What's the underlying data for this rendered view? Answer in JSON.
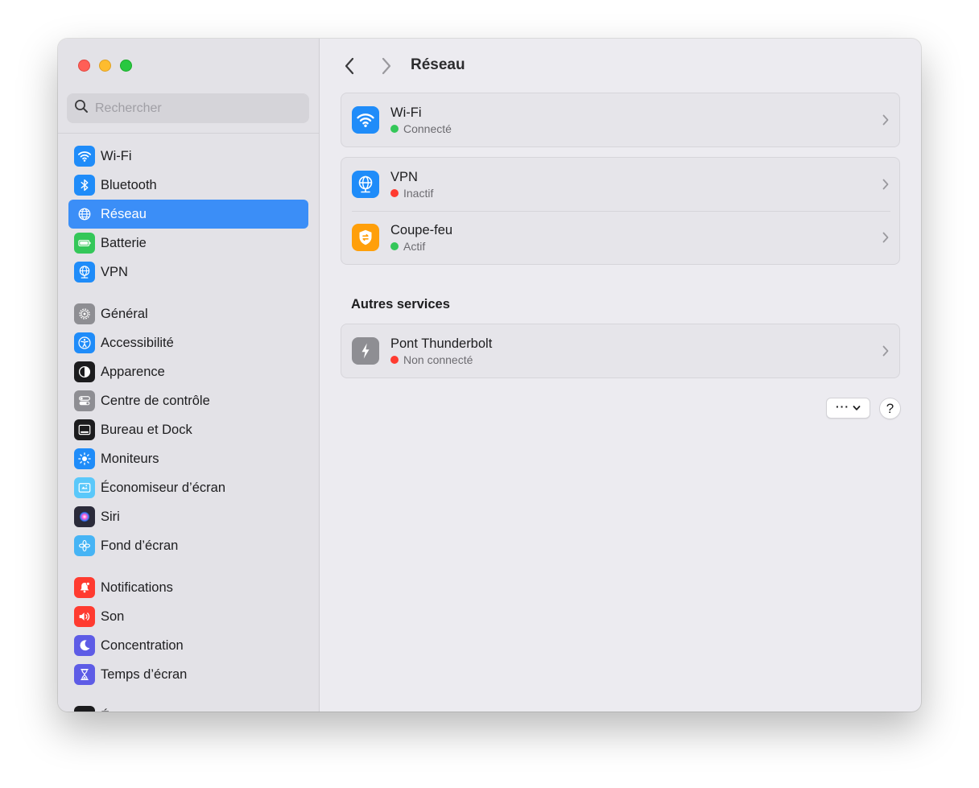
{
  "window": {
    "title": "Réseau"
  },
  "search": {
    "placeholder": "Rechercher"
  },
  "sidebar": {
    "groups": [
      [
        {
          "label": "Wi-Fi",
          "icon": "wifi-icon",
          "color": "#1f8cf9"
        },
        {
          "label": "Bluetooth",
          "icon": "bluetooth-icon",
          "color": "#1f8cf9"
        },
        {
          "label": "Réseau",
          "icon": "globe-icon",
          "color": "#1f8cf9",
          "selected": true
        },
        {
          "label": "Batterie",
          "icon": "battery-icon",
          "color": "#34c759"
        },
        {
          "label": "VPN",
          "icon": "vpn-globe-icon",
          "color": "#1f8cf9"
        }
      ],
      [
        {
          "label": "Général",
          "icon": "gear-icon",
          "color": "#8e8e93"
        },
        {
          "label": "Accessibilité",
          "icon": "accessibility-icon",
          "color": "#1f8cf9"
        },
        {
          "label": "Apparence",
          "icon": "appearance-icon",
          "color": "#1c1c1e"
        },
        {
          "label": "Centre de contrôle",
          "icon": "control-center-icon",
          "color": "#8e8e93"
        },
        {
          "label": "Bureau et Dock",
          "icon": "dock-icon",
          "color": "#1c1c1e"
        },
        {
          "label": "Moniteurs",
          "icon": "sun-icon",
          "color": "#1f8cf9"
        },
        {
          "label": "Économiseur d’écran",
          "icon": "screensaver-icon",
          "color": "#5ac8fa"
        },
        {
          "label": "Siri",
          "icon": "siri-icon",
          "color": "#2b2b3a"
        },
        {
          "label": "Fond d’écran",
          "icon": "flower-icon",
          "color": "#46b4f5"
        }
      ],
      [
        {
          "label": "Notifications",
          "icon": "bell-icon",
          "color": "#ff3b30"
        },
        {
          "label": "Son",
          "icon": "speaker-icon",
          "color": "#ff3b30"
        },
        {
          "label": "Concentration",
          "icon": "moon-icon",
          "color": "#5e5ce6"
        },
        {
          "label": "Temps d’écran",
          "icon": "hourglass-icon",
          "color": "#5e5ce6"
        }
      ],
      [
        {
          "label": "É",
          "icon": "partial-icon",
          "color": "#1c1c1e"
        }
      ]
    ]
  },
  "main": {
    "cards": [
      {
        "rows": [
          {
            "title": "Wi-Fi",
            "status": "Connecté",
            "status_color": "#34c759",
            "icon": "wifi-icon",
            "icon_color": "#1f8cf9"
          }
        ]
      },
      {
        "rows": [
          {
            "title": "VPN",
            "status": "Inactif",
            "status_color": "#ff3b30",
            "icon": "vpn-globe-icon",
            "icon_color": "#1f8cf9"
          },
          {
            "title": "Coupe-feu",
            "status": "Actif",
            "status_color": "#34c759",
            "icon": "firewall-shield-icon",
            "icon_color": "#ff9f0a"
          }
        ]
      }
    ],
    "other_services": {
      "title": "Autres services",
      "rows": [
        {
          "title": "Pont Thunderbolt",
          "status": "Non connecté",
          "status_color": "#ff3b30",
          "icon": "thunderbolt-icon",
          "icon_color": "#8e8e93"
        }
      ]
    },
    "more_label": "···",
    "help_label": "?"
  }
}
